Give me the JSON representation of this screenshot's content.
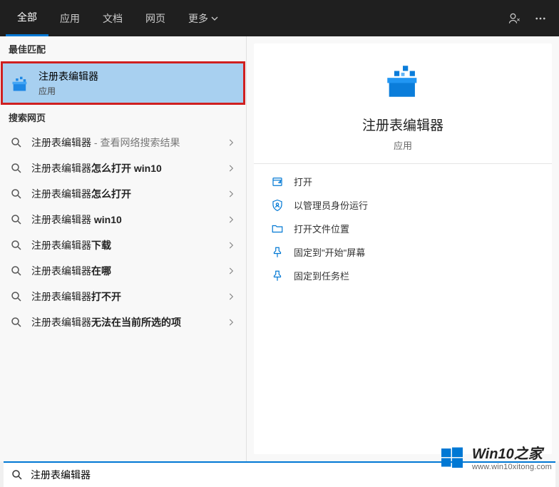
{
  "tabs": {
    "all": "全部",
    "apps": "应用",
    "docs": "文档",
    "web": "网页",
    "more": "更多"
  },
  "sections": {
    "best_match": "最佳匹配",
    "search_web": "搜索网页"
  },
  "best_match": {
    "title": "注册表编辑器",
    "subtitle": "应用"
  },
  "search_results": [
    {
      "prefix": "注册表编辑器",
      "suffix": "",
      "hint": " - 查看网络搜索结果"
    },
    {
      "prefix": "注册表编辑器",
      "suffix": "怎么打开 win10",
      "hint": ""
    },
    {
      "prefix": "注册表编辑器",
      "suffix": "怎么打开",
      "hint": ""
    },
    {
      "prefix": "注册表编辑器",
      "suffix": " win10",
      "hint": ""
    },
    {
      "prefix": "注册表编辑器",
      "suffix": "下载",
      "hint": ""
    },
    {
      "prefix": "注册表编辑器",
      "suffix": "在哪",
      "hint": ""
    },
    {
      "prefix": "注册表编辑器",
      "suffix": "打不开",
      "hint": ""
    },
    {
      "prefix": "注册表编辑器",
      "suffix": "无法在当前所选的项",
      "hint": ""
    }
  ],
  "right_panel": {
    "title": "注册表编辑器",
    "subtitle": "应用",
    "actions": {
      "open": "打开",
      "run_admin": "以管理员身份运行",
      "open_location": "打开文件位置",
      "pin_start": "固定到\"开始\"屏幕",
      "pin_taskbar": "固定到任务栏"
    }
  },
  "search": {
    "value": "注册表编辑器"
  },
  "watermark": {
    "title": "Win10之家",
    "url": "www.win10xitong.com"
  }
}
